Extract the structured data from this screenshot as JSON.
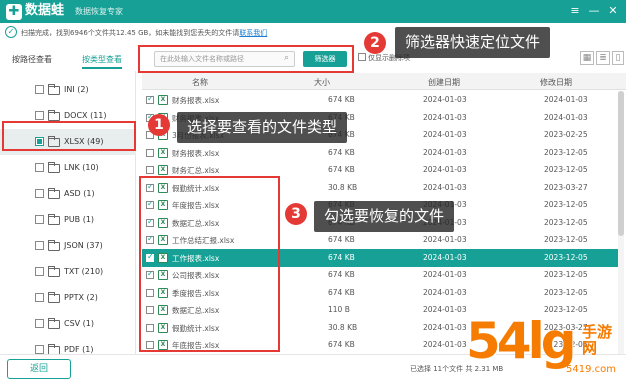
{
  "titlebar": {
    "logo_glyph": "✚",
    "app_name": "数据蛙",
    "subtitle": "数据恢复专家",
    "menu_glyph": "≡",
    "minimize_glyph": "—",
    "close_glyph": "✕"
  },
  "status": {
    "text": "扫描完成，找到6946个文件共12.45 GB，如未能找到您丢失的文件请",
    "link": "联系我们"
  },
  "tabs": [
    "按路径查看",
    "按类型查看"
  ],
  "search": {
    "placeholder": "在此处输入文件名称或路径",
    "filter_button": "筛选器",
    "only_show": "仅显示删除项"
  },
  "sidebar": {
    "items": [
      {
        "label": "INI (2)",
        "checked": false
      },
      {
        "label": "DOCX (11)",
        "checked": false
      },
      {
        "label": "XLSX (49)",
        "checked": true,
        "selected": true
      },
      {
        "label": "LNK (10)",
        "checked": false
      },
      {
        "label": "ASD (1)",
        "checked": false
      },
      {
        "label": "PUB (1)",
        "checked": false
      },
      {
        "label": "JSON (37)",
        "checked": false
      },
      {
        "label": "TXT (210)",
        "checked": false
      },
      {
        "label": "PPTX (2)",
        "checked": false
      },
      {
        "label": "CSV (1)",
        "checked": false
      },
      {
        "label": "PDF (1)",
        "checked": false
      }
    ]
  },
  "table": {
    "headers": {
      "name": "名称",
      "size": "大小",
      "created": "创建日期",
      "modified": "修改日期"
    },
    "rows": [
      {
        "name": "财务报表.xlsx",
        "size": "674 KB",
        "created": "2024-01-03",
        "modified": "2024-01-03",
        "checked": true
      },
      {
        "name": "财务报表.xlsx",
        "size": "674 KB",
        "created": "2024-01-03",
        "modified": "2024-01-03",
        "checked": true
      },
      {
        "name": "3月份报表.xlsx",
        "size": "674 KB",
        "created": "2024-01-03",
        "modified": "2023-02-25",
        "checked": false
      },
      {
        "name": "财务报表.xlsx",
        "size": "674 KB",
        "created": "2024-01-03",
        "modified": "2023-12-05",
        "checked": false
      },
      {
        "name": "财务汇总.xlsx",
        "size": "674 KB",
        "created": "2024-01-03",
        "modified": "2023-12-05",
        "checked": false
      },
      {
        "name": "假勤统计.xlsx",
        "size": "30.8 KB",
        "created": "2024-01-03",
        "modified": "2023-03-27",
        "checked": true
      },
      {
        "name": "年度报告.xlsx",
        "size": "674 KB",
        "created": "2024-01-03",
        "modified": "2023-12-05",
        "checked": true
      },
      {
        "name": "数据汇总.xlsx",
        "size": "674 KB",
        "created": "2024-01-03",
        "modified": "2023-12-05",
        "checked": true
      },
      {
        "name": "工作总结汇报.xlsx",
        "size": "674 KB",
        "created": "2024-01-03",
        "modified": "2023-12-05",
        "checked": true
      },
      {
        "name": "工作报表.xlsx",
        "size": "674 KB",
        "created": "2024-01-03",
        "modified": "2023-12-05",
        "checked": true,
        "highlight": true
      },
      {
        "name": "公司报表.xlsx",
        "size": "674 KB",
        "created": "2024-01-03",
        "modified": "2023-12-05",
        "checked": true
      },
      {
        "name": "季度报告.xlsx",
        "size": "674 KB",
        "created": "2024-01-03",
        "modified": "2023-12-05",
        "checked": false
      },
      {
        "name": "数据汇总.xlsx",
        "size": "110 B",
        "created": "2024-01-03",
        "modified": "2023-12-05",
        "checked": false
      },
      {
        "name": "假勤统计.xlsx",
        "size": "30.8 KB",
        "created": "2024-01-03",
        "modified": "2023-03-27",
        "checked": false
      },
      {
        "name": "年底报告.xlsx",
        "size": "674 KB",
        "created": "2024-01-03",
        "modified": "2023-12-05",
        "checked": false
      }
    ]
  },
  "footer": {
    "back_button": "返回",
    "selection_info": "已选择 11个文件 共 2.31 MB"
  },
  "callouts": [
    {
      "number": "1",
      "text": "选择要查看的文件类型"
    },
    {
      "number": "2",
      "text": "筛选器快速定位文件"
    },
    {
      "number": "3",
      "text": "勾选要恢复的文件"
    }
  ],
  "watermark": {
    "logo": "54lg",
    "line1": "手游网",
    "line2": "5419.com"
  },
  "colors": {
    "accent": "#17a196",
    "annotation_red": "#e53935",
    "watermark_orange": "#f57c00"
  },
  "icons": {
    "app": "logo-icon",
    "file": "excel-file-icon",
    "folder": "folder-icon",
    "search": "search-icon",
    "status": "check-circle-icon"
  }
}
